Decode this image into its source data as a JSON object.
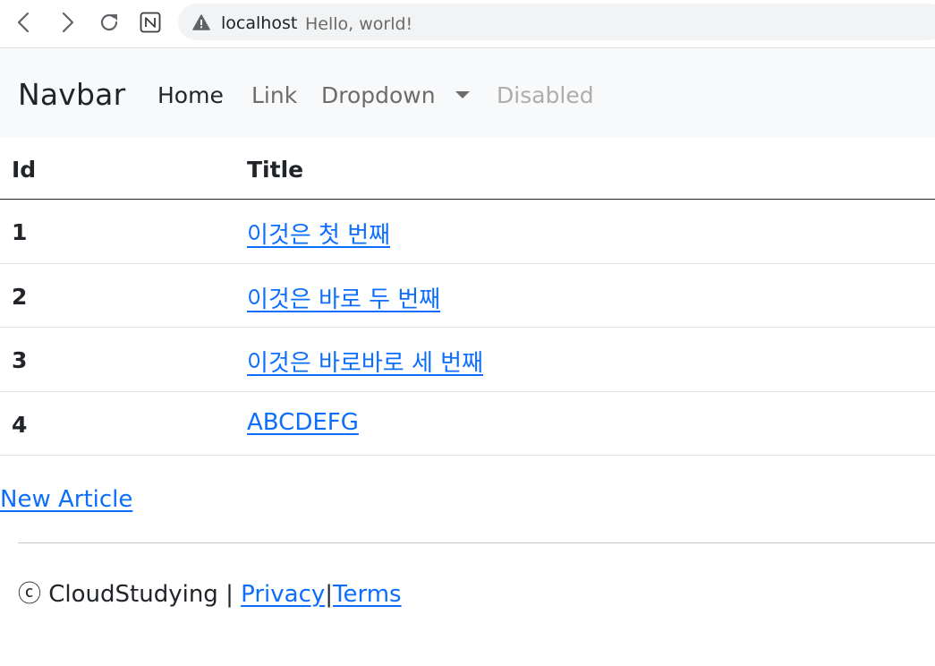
{
  "browser": {
    "host": "localhost",
    "page_title": "Hello, world!",
    "icons": [
      "back-icon",
      "forward-icon",
      "reload-icon",
      "notion-icon",
      "warning-icon"
    ]
  },
  "navbar": {
    "brand": "Navbar",
    "items": [
      {
        "label": "Home",
        "state": "active"
      },
      {
        "label": "Link",
        "state": "normal"
      },
      {
        "label": "Dropdown",
        "state": "dropdown"
      },
      {
        "label": "Disabled",
        "state": "disabled"
      }
    ]
  },
  "table": {
    "headers": {
      "id": "Id",
      "title": "Title"
    },
    "rows": [
      {
        "id": "1",
        "title": "이것은 첫 번째"
      },
      {
        "id": "2",
        "title": "이것은 바로 두 번째"
      },
      {
        "id": "3",
        "title": "이것은 바로바로 세 번째"
      },
      {
        "id": "4",
        "title": "ABCDEFG"
      }
    ]
  },
  "new_article": "New Article",
  "footer": {
    "copyright": "ⓒ CloudStudying | ",
    "privacy": "Privacy",
    "separator": "|",
    "terms": "Terms"
  },
  "colors": {
    "link": "#0d6efd",
    "navbar_bg": "#f8f9fa",
    "text": "#212529",
    "disabled": "#adadad"
  }
}
